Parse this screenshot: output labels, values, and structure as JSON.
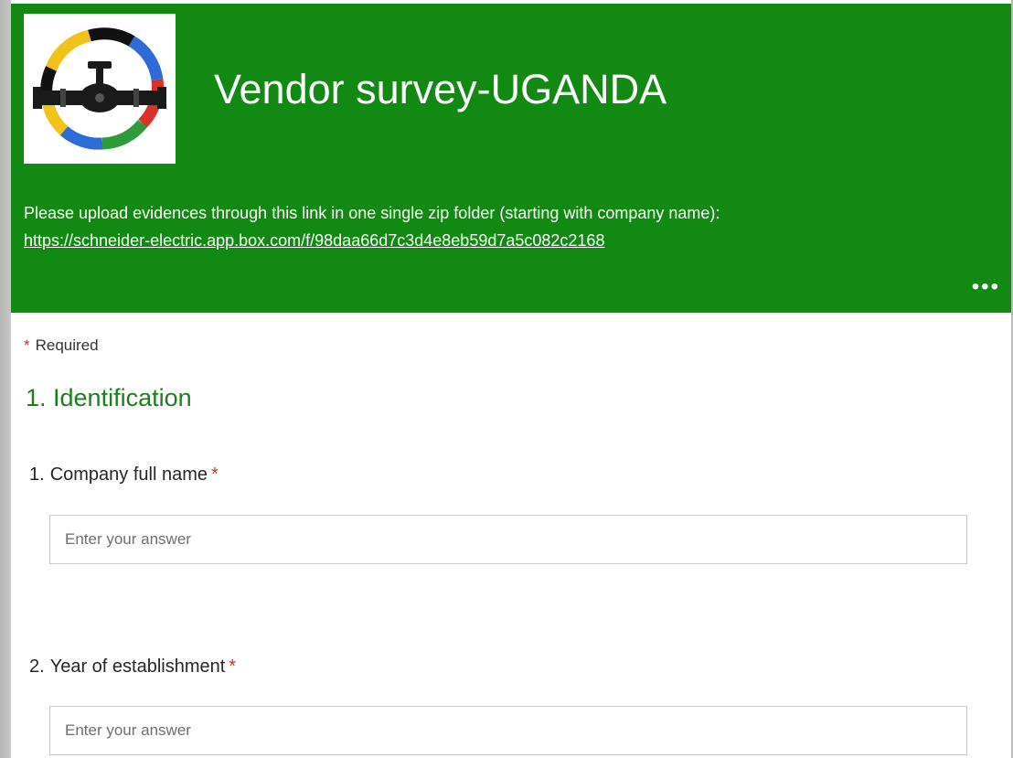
{
  "form": {
    "title": "Vendor survey-UGANDA",
    "description_text": "Please upload evidences through this link in one single zip folder (starting with company name): ",
    "description_link": "https://schneider-electric.app.box.com/f/98daa66d7c3d4e8eb59d7a5c082c2168",
    "more_icon": "more-options-icon",
    "logo_icon": "pipe-valve-ring-logo"
  },
  "required_note": {
    "star": "*",
    "label": "Required"
  },
  "section": {
    "title": "1. Identification"
  },
  "questions": [
    {
      "number": "1.",
      "label": "Company full name",
      "required_star": "*",
      "placeholder": "Enter your answer"
    },
    {
      "number": "2.",
      "label": "Year of establishment",
      "required_star": "*",
      "placeholder": "Enter your answer"
    }
  ],
  "colors": {
    "header_green": "#128912",
    "section_title_green": "#1b7f1b",
    "required_red": "#c0392b"
  }
}
